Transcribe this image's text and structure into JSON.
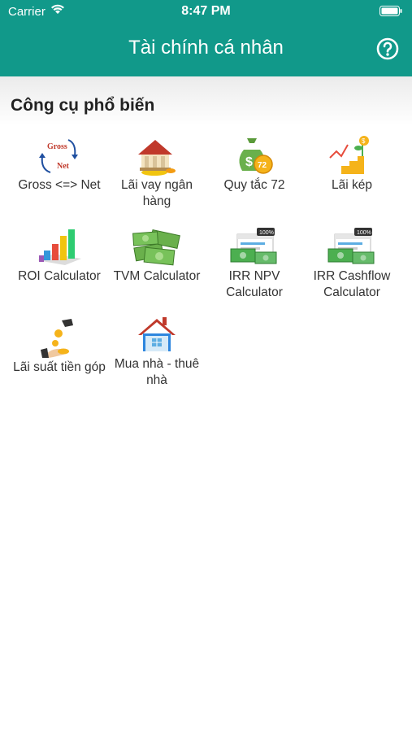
{
  "status": {
    "carrier": "Carrier",
    "time": "8:47 PM"
  },
  "header": {
    "title": "Tài chính cá nhân",
    "help_icon": "help-circle-icon"
  },
  "section": {
    "title": "Công cụ phổ biến"
  },
  "tools": [
    {
      "label": "Gross <=> Net",
      "icon": "gross-net-icon"
    },
    {
      "label": "Lãi vay ngân hàng",
      "icon": "bank-icon"
    },
    {
      "label": "Quy tắc 72",
      "icon": "money-bag-icon"
    },
    {
      "label": "Lãi kép",
      "icon": "compound-growth-icon"
    },
    {
      "label": "ROI Calculator",
      "icon": "bar-chart-icon"
    },
    {
      "label": "TVM Calculator",
      "icon": "cash-stack-icon"
    },
    {
      "label": "IRR NPV Calculator",
      "icon": "cash-percent-icon"
    },
    {
      "label": "IRR Cashflow Calculator",
      "icon": "cash-percent-icon"
    },
    {
      "label": "Lãi suất tiền góp",
      "icon": "coin-hand-icon"
    },
    {
      "label": "Mua nhà - thuê nhà",
      "icon": "house-icon"
    }
  ],
  "colors": {
    "header": "#11998a",
    "icon_green": "#4caf50",
    "icon_orange": "#f5a623"
  }
}
